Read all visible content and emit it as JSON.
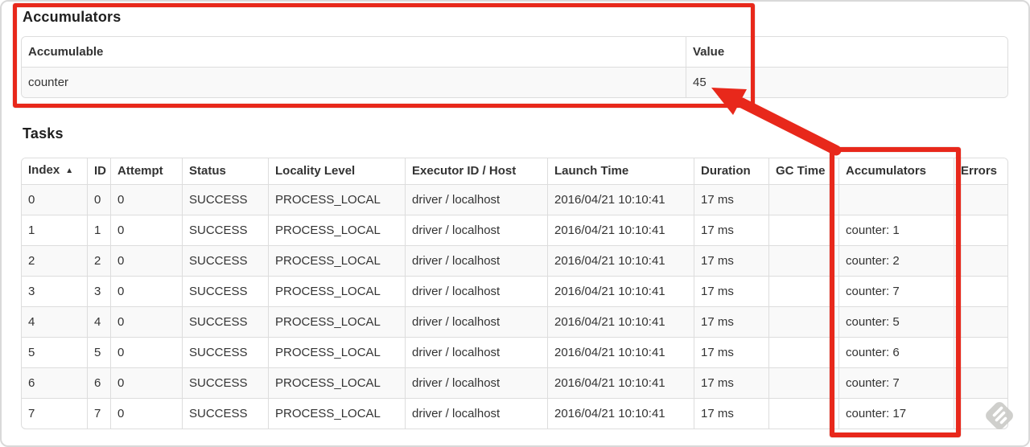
{
  "accumulators_section": {
    "title": "Accumulators",
    "table": {
      "headers": [
        "Accumulable",
        "Value"
      ],
      "rows": [
        {
          "accumulable": "counter",
          "value": "45"
        }
      ]
    }
  },
  "tasks_section": {
    "title": "Tasks",
    "table": {
      "headers": [
        "Index",
        "ID",
        "Attempt",
        "Status",
        "Locality Level",
        "Executor ID / Host",
        "Launch Time",
        "Duration",
        "GC Time",
        "Accumulators",
        "Errors"
      ],
      "sort": {
        "column": "Index",
        "direction": "asc",
        "icon": "▲"
      },
      "rows": [
        {
          "index": "0",
          "id": "0",
          "attempt": "0",
          "status": "SUCCESS",
          "locality_level": "PROCESS_LOCAL",
          "executor_id_host": "driver / localhost",
          "launch_time": "2016/04/21 10:10:41",
          "duration": "17 ms",
          "gc_time": "",
          "accumulators": "",
          "errors": ""
        },
        {
          "index": "1",
          "id": "1",
          "attempt": "0",
          "status": "SUCCESS",
          "locality_level": "PROCESS_LOCAL",
          "executor_id_host": "driver / localhost",
          "launch_time": "2016/04/21 10:10:41",
          "duration": "17 ms",
          "gc_time": "",
          "accumulators": "counter: 1",
          "errors": ""
        },
        {
          "index": "2",
          "id": "2",
          "attempt": "0",
          "status": "SUCCESS",
          "locality_level": "PROCESS_LOCAL",
          "executor_id_host": "driver / localhost",
          "launch_time": "2016/04/21 10:10:41",
          "duration": "17 ms",
          "gc_time": "",
          "accumulators": "counter: 2",
          "errors": ""
        },
        {
          "index": "3",
          "id": "3",
          "attempt": "0",
          "status": "SUCCESS",
          "locality_level": "PROCESS_LOCAL",
          "executor_id_host": "driver / localhost",
          "launch_time": "2016/04/21 10:10:41",
          "duration": "17 ms",
          "gc_time": "",
          "accumulators": "counter: 7",
          "errors": ""
        },
        {
          "index": "4",
          "id": "4",
          "attempt": "0",
          "status": "SUCCESS",
          "locality_level": "PROCESS_LOCAL",
          "executor_id_host": "driver / localhost",
          "launch_time": "2016/04/21 10:10:41",
          "duration": "17 ms",
          "gc_time": "",
          "accumulators": "counter: 5",
          "errors": ""
        },
        {
          "index": "5",
          "id": "5",
          "attempt": "0",
          "status": "SUCCESS",
          "locality_level": "PROCESS_LOCAL",
          "executor_id_host": "driver / localhost",
          "launch_time": "2016/04/21 10:10:41",
          "duration": "17 ms",
          "gc_time": "",
          "accumulators": "counter: 6",
          "errors": ""
        },
        {
          "index": "6",
          "id": "6",
          "attempt": "0",
          "status": "SUCCESS",
          "locality_level": "PROCESS_LOCAL",
          "executor_id_host": "driver / localhost",
          "launch_time": "2016/04/21 10:10:41",
          "duration": "17 ms",
          "gc_time": "",
          "accumulators": "counter: 7",
          "errors": ""
        },
        {
          "index": "7",
          "id": "7",
          "attempt": "0",
          "status": "SUCCESS",
          "locality_level": "PROCESS_LOCAL",
          "executor_id_host": "driver / localhost",
          "launch_time": "2016/04/21 10:10:41",
          "duration": "17 ms",
          "gc_time": "",
          "accumulators": "counter: 17",
          "errors": ""
        }
      ]
    }
  },
  "annotations": {
    "color": "#e8281b",
    "boxes": [
      "accumulators-section",
      "accumulators-column"
    ],
    "arrow": "from accumulators column to value 45"
  },
  "watermark": "skitch-icon"
}
